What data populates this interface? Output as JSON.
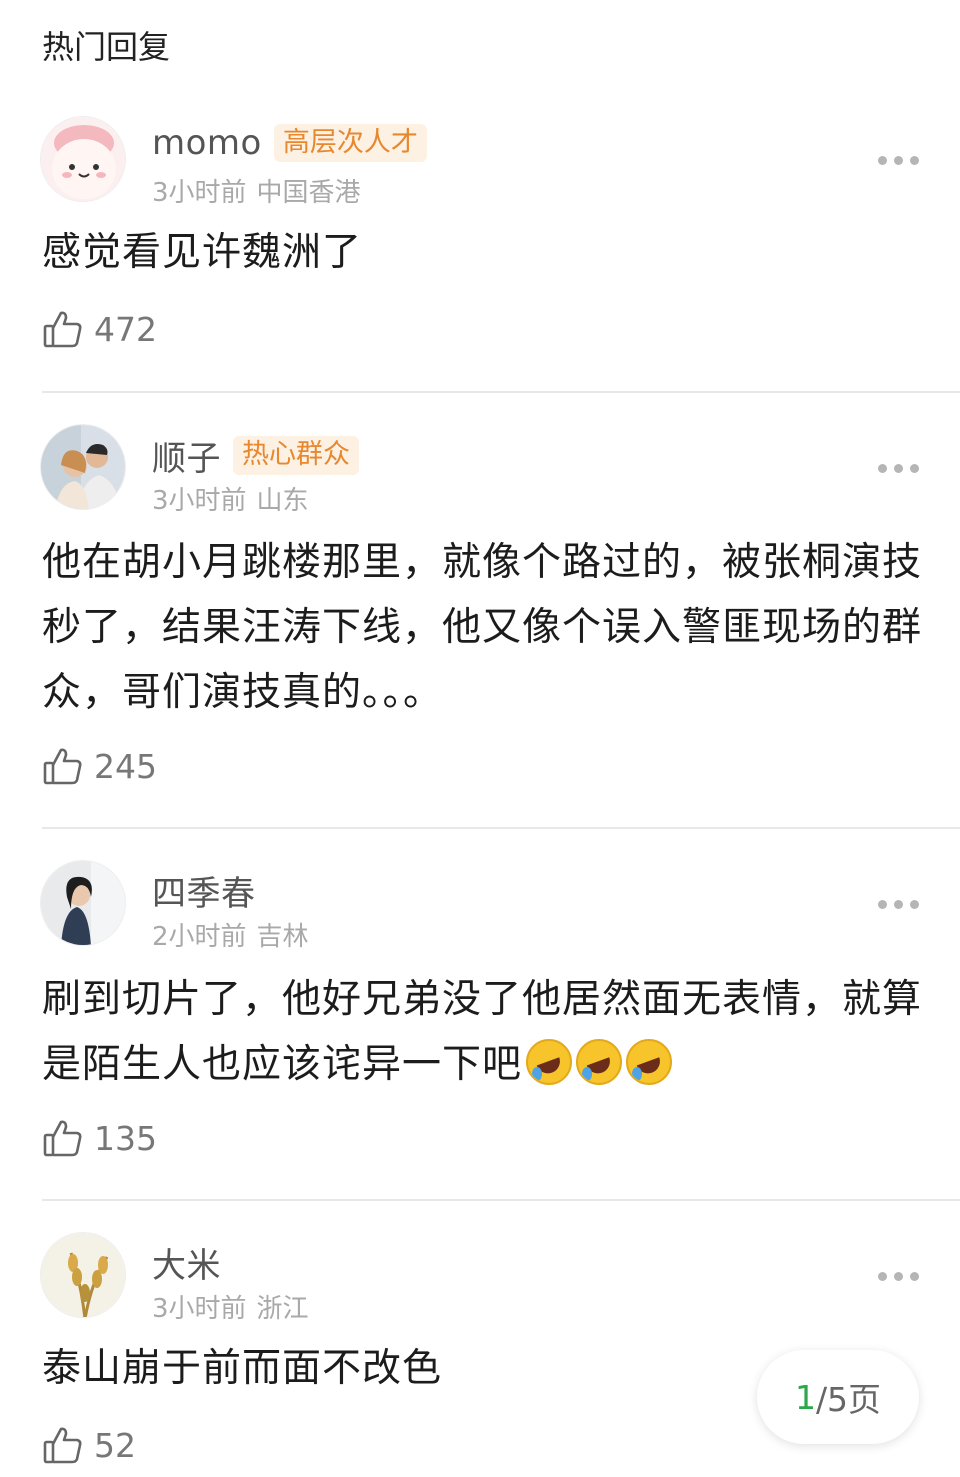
{
  "section_title": "热门回复",
  "comments": [
    {
      "username": "momo",
      "badge": "高层次人才",
      "time": "3小时前",
      "location": "中国香港",
      "text": "感觉看见许魏洲了",
      "likes": "472"
    },
    {
      "username": "顺子",
      "badge": "热心群众",
      "time": "3小时前",
      "location": "山东",
      "text": "他在胡小月跳楼那里，就像个路过的，被张桐演技秒了，结果汪涛下线，他又像个误入警匪现场的群众，哥们演技真的。。。",
      "likes": "245"
    },
    {
      "username": "四季春",
      "badge": "",
      "time": "2小时前",
      "location": "吉林",
      "text": "刷到切片了，他好兄弟没了他居然面无表情，就算是陌生人也应该诧异一下吧",
      "emoji": "rolling-on-floor-laughing-emoji",
      "likes": "135"
    },
    {
      "username": "大米",
      "badge": "",
      "time": "3小时前",
      "location": "浙江",
      "text": "泰山崩于前而面不改色",
      "likes": "52"
    }
  ],
  "pager": {
    "current": "1",
    "total_text": "/5页"
  },
  "icons": {
    "like": "thumbs-up-icon",
    "more": "more-dots-icon"
  },
  "colors": {
    "badge_text": "#e8882e",
    "badge_bg": "#fdf1e3",
    "pager_current": "#2aa84a"
  }
}
